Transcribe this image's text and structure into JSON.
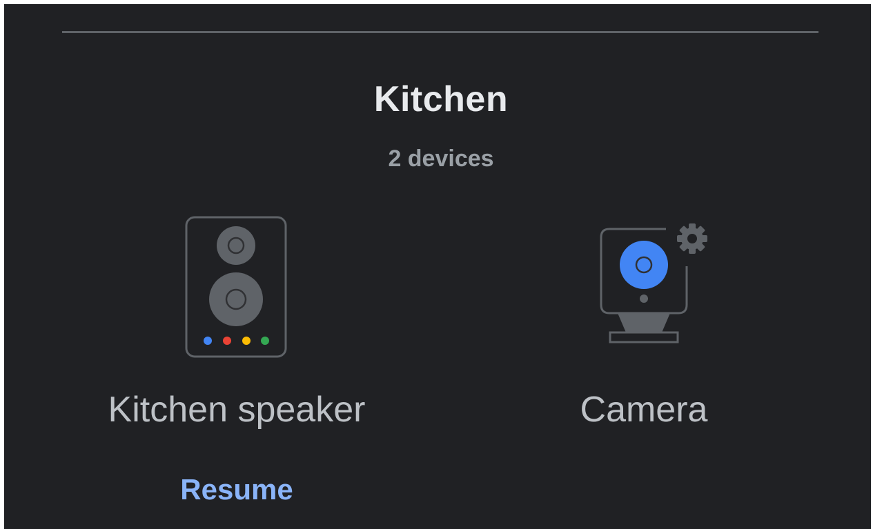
{
  "room": {
    "title": "Kitchen",
    "device_count_label": "2 devices"
  },
  "devices": [
    {
      "name": "Kitchen speaker",
      "icon": "smart-speaker-icon",
      "action_label": "Resume"
    },
    {
      "name": "Camera",
      "icon": "security-camera-icon",
      "badge_icon": "gear-icon"
    }
  ],
  "colors": {
    "background": "#202124",
    "title": "#e8eaed",
    "subtitle": "#9aa0a6",
    "device_name": "#bdc1c6",
    "action": "#8ab4f8",
    "camera_lens": "#4285f4",
    "dot_blue": "#4285f4",
    "dot_red": "#ea4335",
    "dot_yellow": "#fbbc04",
    "dot_green": "#34a853"
  }
}
